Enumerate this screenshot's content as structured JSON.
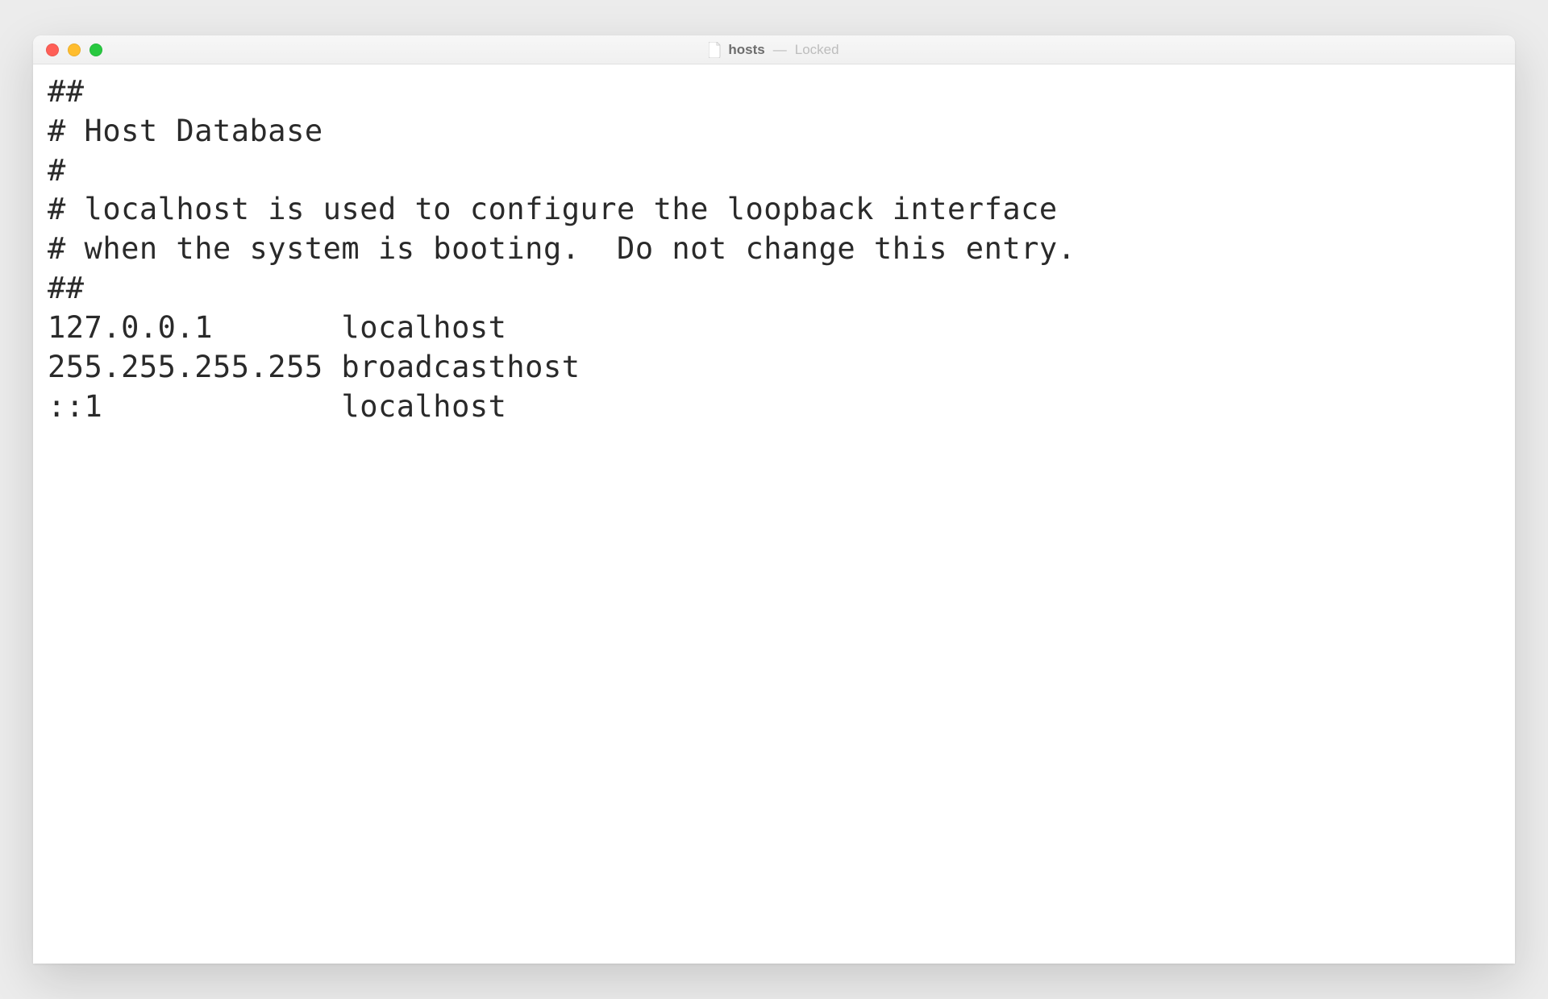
{
  "titlebar": {
    "filename": "hosts",
    "separator": "—",
    "status": "Locked"
  },
  "file": {
    "lines": [
      "##",
      "# Host Database",
      "#",
      "# localhost is used to configure the loopback interface",
      "# when the system is booting.  Do not change this entry.",
      "##",
      "127.0.0.1       localhost",
      "255.255.255.255 broadcasthost",
      "::1             localhost"
    ]
  }
}
